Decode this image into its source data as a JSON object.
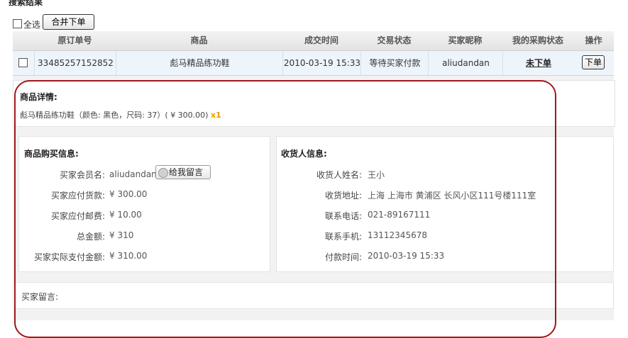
{
  "page": {
    "title": "搜索结果"
  },
  "toolbar": {
    "select_all_label": "全选",
    "merge_order_label": "合并下单"
  },
  "table": {
    "headers": [
      "原订单号",
      "商品",
      "成交时间",
      "交易状态",
      "买家昵称",
      "我的采购状态",
      "操作"
    ],
    "row": {
      "order_no": "33485257152852",
      "product": "彪马精品练功鞋",
      "deal_time": "2010-03-19 15:33",
      "trade_status": "等待买家付款",
      "buyer_nick": "aliudandan",
      "purchase_status": "未下单",
      "action_label": "下单"
    }
  },
  "product_detail": {
    "title": "商品详情:",
    "line_text": "彪马精品练功鞋（颜色: 黑色，尺码: 37）( ¥ 300.00)",
    "qty": "x1"
  },
  "purchase_info": {
    "title": "商品购买信息:",
    "member_label": "买家会员名:",
    "member_value": "aliudandan",
    "leave_message_label": "给我留言",
    "payable_label": "买家应付货款:",
    "payable_value": "¥ 300.00",
    "postage_label": "买家应付邮费:",
    "postage_value": "¥ 10.00",
    "total_label": "总金额:",
    "total_value": "¥ 310",
    "actual_label": "买家实际支付金额:",
    "actual_value": "¥ 310.00"
  },
  "receiver_info": {
    "title": "收货人信息:",
    "name_label": "收货人姓名:",
    "name_value": "王小",
    "address_label": "收货地址:",
    "address_value": "上海 上海市 黄浦区 长风小区111号楼111室",
    "phone_label": "联系电话:",
    "phone_value": "021-89167111",
    "mobile_label": "联系手机:",
    "mobile_value": "13112345678",
    "paytime_label": "付款时间:",
    "paytime_value": "2010-03-19 15:33"
  },
  "buyer_message": {
    "title": "买家留言:"
  },
  "colors": {
    "highlight_outline": "#a01818",
    "qty_color": "#e89a00",
    "row_bg": "#eef4fb"
  }
}
